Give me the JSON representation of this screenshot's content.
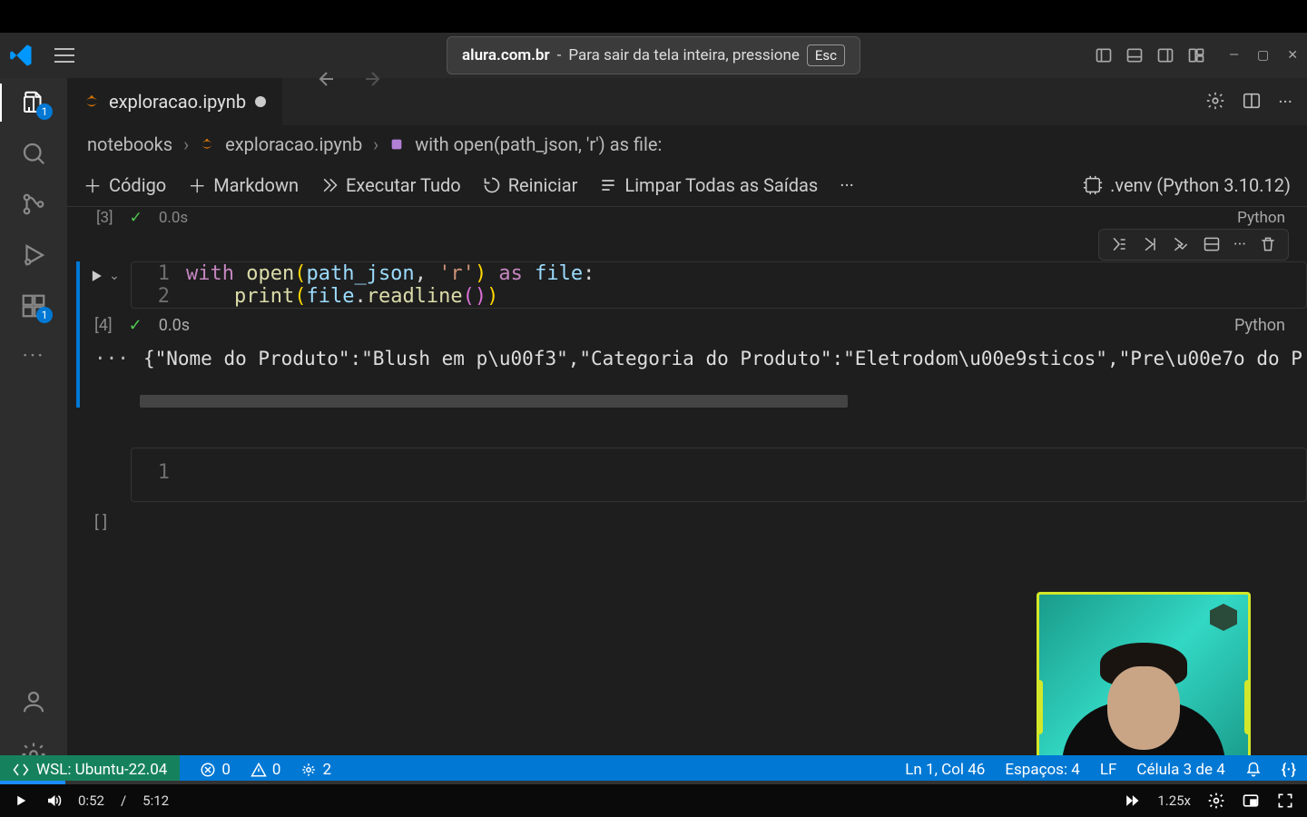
{
  "titlebar": {
    "overlay_site": "alura.com.br",
    "overlay_sep": " - ",
    "overlay_text": "Para sair da tela inteira, pressione",
    "overlay_key": "Esc"
  },
  "activity": {
    "explorer_badge": "1",
    "extensions_badge": "1"
  },
  "tab": {
    "filename": "exploracao.ipynb"
  },
  "breadcrumb": {
    "folder": "notebooks",
    "file": "exploracao.ipynb",
    "symbol": "with open(path_json, 'r') as file:"
  },
  "toolbar": {
    "code": "Código",
    "markdown": "Markdown",
    "run_all": "Executar Tudo",
    "restart": "Reiniciar",
    "clear": "Limpar Todas as Saídas",
    "kernel": ".venv (Python 3.10.12)"
  },
  "prev_cell": {
    "exec": "[3]",
    "time": "0.0s",
    "lang": "Python"
  },
  "cell": {
    "line1_num": "1",
    "line2_num": "2",
    "code_tokens": {
      "with": "with",
      "open": "open",
      "lp": "(",
      "path_json": "path_json",
      "comma": ", ",
      "r": "'r'",
      "rp": ")",
      "as": " as ",
      "file": "file",
      "colon": ":",
      "indent": "    ",
      "print": "print",
      "lp2": "(",
      "file2": "file",
      "dot": ".",
      "readline": "readline",
      "lp3": "(",
      "rp3": ")",
      "rp2": ")"
    },
    "exec": "[4]",
    "time": "0.0s",
    "lang": "Python",
    "output": "{\"Nome do Produto\":\"Blush em p\\u00f3\",\"Categoria do Produto\":\"Eletrodom\\u00e9sticos\",\"Pre\\u00e7o do P"
  },
  "empty_cell": {
    "line1_num": "1",
    "exec": "[ ]"
  },
  "status": {
    "wsl": "WSL: Ubuntu-22.04",
    "errors": "0",
    "warnings": "0",
    "ports": "2",
    "cursor": "Ln 1, Col 46",
    "spaces": "Espaços: 4",
    "eol": "LF",
    "cell": "Célula 3 de 4"
  },
  "video": {
    "current": "0:52",
    "sep": "/",
    "total": "5:12",
    "speed": "1.25x"
  }
}
